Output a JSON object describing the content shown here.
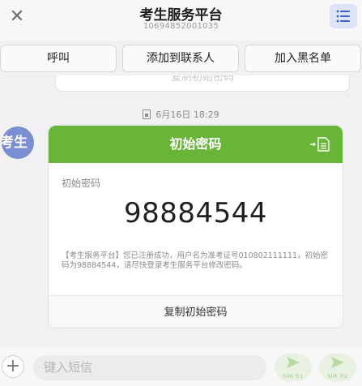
{
  "header": {
    "title": "考生服务平台",
    "number": "10694852001035"
  },
  "actions": {
    "call": "呼叫",
    "add_contact": "添加到联系人",
    "block": "加入黑名单"
  },
  "previous_message": {
    "partial_label": "复制初始密码"
  },
  "message": {
    "timestamp": "6月16日 18:29",
    "avatar_text": "考生",
    "card_title": "初始密码",
    "field_label": "初始密码",
    "code": "98884544",
    "body": "【考生服务平台】您已注册成功，用户名为准考证号010802111111，初始密码为98884544，请尽快登录考生服务平台修改密码。",
    "copy_label": "复制初始密码"
  },
  "composer": {
    "placeholder": "键入短信",
    "sim1_label": "SIM 卡1",
    "sim2_label": "SIM 卡2"
  },
  "colors": {
    "accent_green": "#69b53a",
    "menu_blue": "#dde4f6",
    "avatar_blue": "#7a8fd1"
  }
}
